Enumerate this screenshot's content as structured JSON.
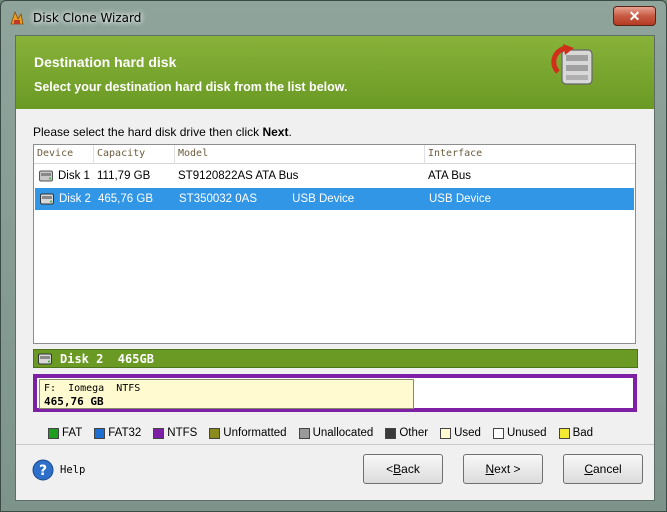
{
  "window": {
    "title": "Disk Clone Wizard",
    "close_label": "✕"
  },
  "header": {
    "title": "Destination hard disk",
    "subtitle": "Select your destination hard disk from the list below."
  },
  "instruction": {
    "text": "Please select the hard disk drive then click ",
    "emphasis": "Next",
    "end": "."
  },
  "table": {
    "columns": [
      "Device",
      "Capacity",
      "Model",
      "Interface"
    ],
    "rows": [
      {
        "device": "Disk 1",
        "capacity": "111,79 GB",
        "model": "ST9120822AS ATA Bus",
        "interface": "ATA Bus",
        "selected": false
      },
      {
        "device": "Disk 2",
        "capacity": "465,76 GB",
        "model": "ST350032 0AS           USB Device",
        "interface": "USB Device",
        "selected": true
      }
    ]
  },
  "disk_bar": {
    "label": "Disk 2  465GB"
  },
  "partition": {
    "name": "F:  Iomega  NTFS",
    "size": "465,76 GB",
    "used_fraction": 0.63
  },
  "legend": [
    {
      "label": "FAT",
      "color": "#1e9e1e"
    },
    {
      "label": "FAT32",
      "color": "#1c6fd0"
    },
    {
      "label": "NTFS",
      "color": "#7d20a6"
    },
    {
      "label": "Unformatted",
      "color": "#8c8c1e"
    },
    {
      "label": "Unallocated",
      "color": "#9a9a9a"
    },
    {
      "label": "Other",
      "color": "#3a3a3a"
    },
    {
      "label": "Used",
      "color": "#fffacf"
    },
    {
      "label": "Unused",
      "color": "#ffffff"
    },
    {
      "label": "Bad",
      "color": "#f5e830"
    }
  ],
  "footer": {
    "help_label": "Help",
    "back_label": "< Back",
    "back_key": "B",
    "next_label": "Next >",
    "next_key": "N",
    "cancel_label": "Cancel",
    "cancel_key": "C"
  },
  "colors": {
    "accent_green": "#6a9a24",
    "selection_blue": "#3296e6",
    "ntfs_purple": "#7d20a6"
  }
}
